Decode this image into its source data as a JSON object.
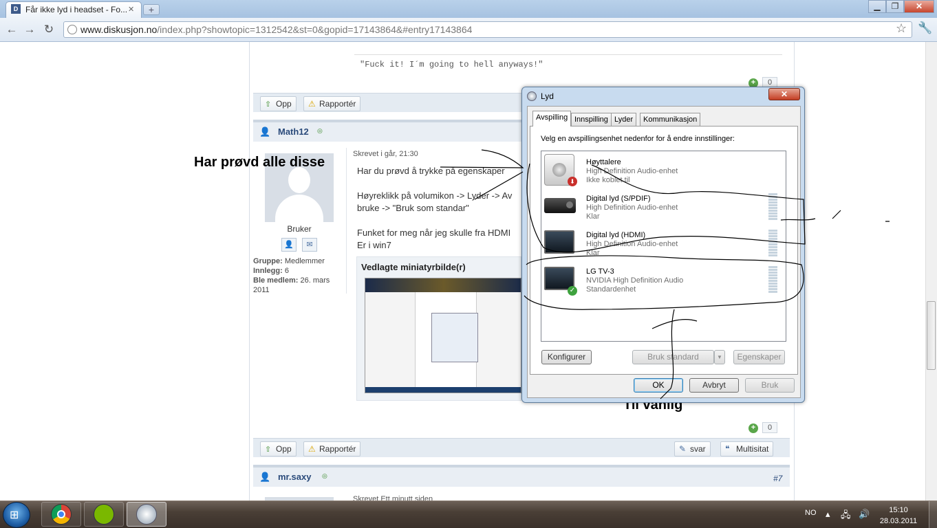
{
  "browser": {
    "tab_title": "Får ikke lyd i headset - Fo...",
    "url_host": "www.diskusjon.no",
    "url_path": "/index.php?showtopic=1312542&st=0&gopid=17143864&#entry17143864",
    "window_buttons": {
      "minimize": "▁",
      "maximize": "❐",
      "close": "✕"
    }
  },
  "forum": {
    "signature": "\"Fuck it! I´m going to hell anyways!\"",
    "vote_count": "0",
    "buttons": {
      "up": "Opp",
      "report": "Rapportér",
      "reply": "svar",
      "multiquote": "Multisitat"
    },
    "post1": {
      "author": "Math12",
      "meta": "Skrevet i går, 21:30",
      "line1": "Har du prøvd å trykke på egenskaper",
      "line2": "Høyreklikk på volumikon -> Lyder -> Av",
      "line3": "bruke -> \"Bruk som standar\"",
      "line4": "Funket for meg når jeg skulle fra HDMI",
      "line5": "Er i win7",
      "role": "Bruker",
      "group_label": "Gruppe:",
      "group_value": "Medlemmer",
      "posts_label": "Innlegg:",
      "posts_value": "6",
      "member_label": "Ble medlem:",
      "member_value": "26. mars 2011",
      "attach_title": "Vedlagte miniatyrbilde(r)"
    },
    "post2": {
      "author": "mr.saxy",
      "number": "#7",
      "meta": "Skrevet Ett minutt siden"
    }
  },
  "annotations": {
    "left": "Har prøvd alle disse",
    "bottom": "Til vanlig"
  },
  "dialog": {
    "title": "Lyd",
    "close": "✕",
    "tabs": [
      "Avspilling",
      "Innspilling",
      "Lyder",
      "Kommunikasjon"
    ],
    "instruction": "Velg en avspillingsenhet nedenfor for å endre innstillinger:",
    "devices": [
      {
        "name": "Høyttalere",
        "driver": "High Definition Audio-enhet",
        "status": "Ikke koblet til"
      },
      {
        "name": "Digital lyd (S/PDIF)",
        "driver": "High Definition Audio-enhet",
        "status": "Klar"
      },
      {
        "name": "Digital lyd (HDMI)",
        "driver": "High Definition Audio-enhet",
        "status": "Klar"
      },
      {
        "name": "LG TV-3",
        "driver": "NVIDIA High Definition Audio",
        "status": "Standardenhet"
      }
    ],
    "buttons": {
      "configure": "Konfigurer",
      "set_default": "Bruk standard",
      "properties": "Egenskaper",
      "ok": "OK",
      "cancel": "Avbryt",
      "apply": "Bruk"
    }
  },
  "taskbar": {
    "lang": "NO",
    "time": "15:10",
    "date": "28.03.2011"
  }
}
